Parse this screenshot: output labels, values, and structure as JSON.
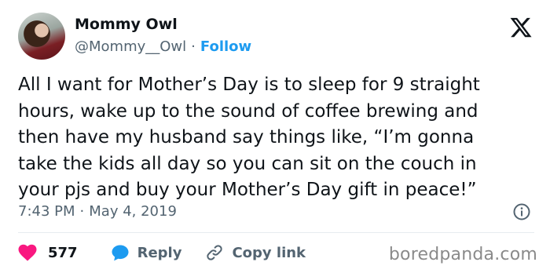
{
  "author": {
    "display_name": "Mommy Owl",
    "handle": "@Mommy__Owl",
    "separator": "·",
    "follow_label": "Follow"
  },
  "tweet": {
    "text": "All I want for Mother’s Day is to sleep for 9 straight\nhours, wake up to the sound of coffee brewing and\nthen have my husband say things like, “I’m gonna\ntake the kids all day so you can sit on the couch in\nyour pjs and buy your Mother’s Day gift in peace!”",
    "time": "7:43 PM",
    "separator": "·",
    "date": "May 4, 2019"
  },
  "actions": {
    "likes_count": "577",
    "reply_label": "Reply",
    "copy_link_label": "Copy link"
  },
  "watermark": "boredpanda.com",
  "icons": {
    "logo": "x-logo-icon",
    "info": "info-icon",
    "like": "heart-icon",
    "reply": "reply-bubble-icon",
    "link": "link-icon"
  },
  "colors": {
    "accent": "#1d9bf0",
    "like": "#f91880",
    "secondary_text": "#536471"
  }
}
